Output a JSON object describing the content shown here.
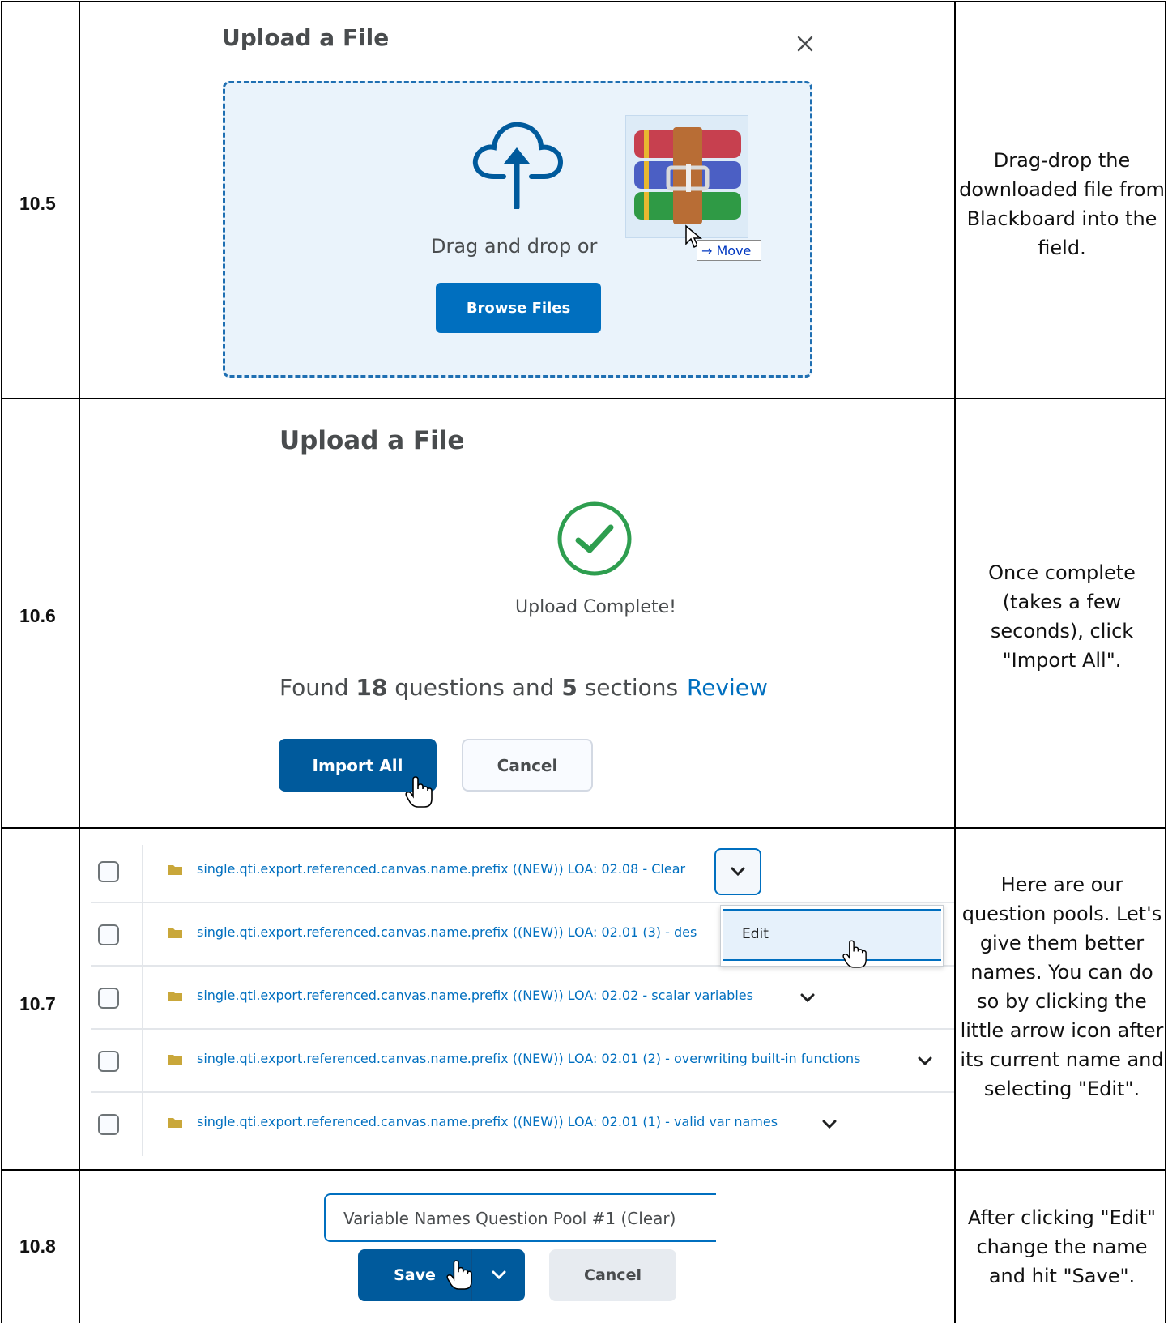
{
  "steps": [
    {
      "number": "10.5",
      "note": "Drag-drop the downloaded file from Blackboard into the field."
    },
    {
      "number": "10.6",
      "note": "Once complete (takes a few seconds), click \"Import All\"."
    },
    {
      "number": "10.7",
      "note": "Here are our question pools. Let's give them better names. You can do so by clicking the little arrow icon after its current name and selecting \"Edit\"."
    },
    {
      "number": "10.8",
      "note": "After clicking \"Edit\" change the name and hit \"Save\"."
    }
  ],
  "upload_dialog": {
    "title": "Upload a File",
    "drag_text": "Drag and drop or",
    "browse_label": "Browse Files",
    "move_tooltip": "→ Move"
  },
  "upload_complete": {
    "title": "Upload a File",
    "status": "Upload Complete!",
    "found_prefix": "Found ",
    "question_count": "18",
    "found_middle": " questions and ",
    "section_count": "5",
    "found_suffix": " sections",
    "review_link": "Review",
    "import_label": "Import All",
    "cancel_label": "Cancel"
  },
  "pools": {
    "items": [
      {
        "name": "single.qti.export.referenced.canvas.name.prefix ((NEW)) LOA: 02.08 - Clear"
      },
      {
        "name": "single.qti.export.referenced.canvas.name.prefix ((NEW)) LOA: 02.01 (3) - des"
      },
      {
        "name": "single.qti.export.referenced.canvas.name.prefix ((NEW)) LOA: 02.02 - scalar variables"
      },
      {
        "name": "single.qti.export.referenced.canvas.name.prefix ((NEW)) LOA: 02.01 (2) - overwriting built-in functions"
      },
      {
        "name": "single.qti.export.referenced.canvas.name.prefix ((NEW)) LOA: 02.01 (1) - valid var names"
      }
    ],
    "menu_edit_label": "Edit"
  },
  "rename": {
    "name_value": "Variable Names Question Pool #1 (Clear)",
    "save_label": "Save",
    "cancel_label": "Cancel"
  },
  "colors": {
    "accent": "#006fbf",
    "accent_dark": "#005a9c",
    "success": "#2e9e4f",
    "dropzone_bg": "#eaf3fb"
  }
}
